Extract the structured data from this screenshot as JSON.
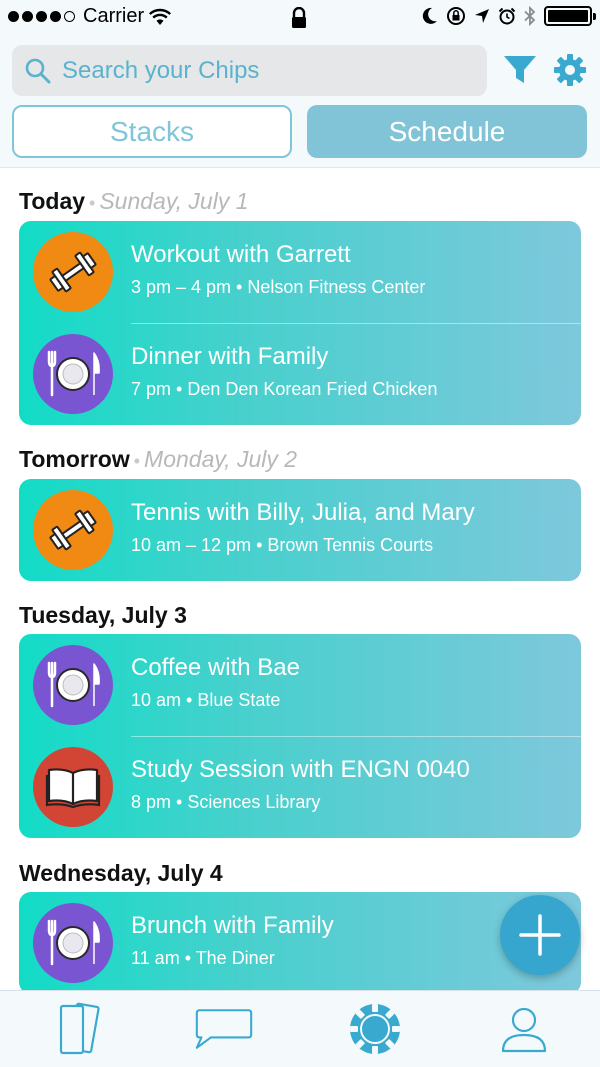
{
  "status_bar": {
    "carrier": "Carrier",
    "signal_dots_filled": 4,
    "signal_dots_total": 5
  },
  "search": {
    "placeholder": "Search your Chips",
    "icon": "search-icon"
  },
  "header": {
    "filter_icon": "filter-icon",
    "settings_icon": "gear-icon",
    "segments": [
      {
        "label": "Stacks",
        "selected": false
      },
      {
        "label": "Schedule",
        "selected": true
      }
    ]
  },
  "days": [
    {
      "label": "Today",
      "date": "Sunday, July 1",
      "events": [
        {
          "title": "Workout with Garrett",
          "subtitle": "3 pm – 4 pm • Nelson Fitness Center",
          "icon": "dumbbell-icon"
        },
        {
          "title": "Dinner with Family",
          "subtitle": "7 pm • Den Den Korean Fried Chicken",
          "icon": "plate-icon"
        }
      ]
    },
    {
      "label": "Tomorrow",
      "date": "Monday, July 2",
      "events": [
        {
          "title": "Tennis with Billy, Julia, and Mary",
          "subtitle": "10 am – 12 pm • Brown Tennis Courts",
          "icon": "dumbbell-icon"
        }
      ]
    },
    {
      "label": "Tuesday, July 3",
      "date": "",
      "events": [
        {
          "title": "Coffee with Bae",
          "subtitle": "10 am • Blue State",
          "icon": "plate-icon"
        },
        {
          "title": "Study Session with ENGN 0040",
          "subtitle": "8 pm • Sciences Library",
          "icon": "book-icon"
        }
      ]
    },
    {
      "label": "Wednesday, July 4",
      "date": "",
      "events": [
        {
          "title": "Brunch with Family",
          "subtitle": "11 am • The Diner",
          "icon": "plate-icon"
        }
      ]
    }
  ],
  "tab_bar": {
    "tabs": [
      "cards-tab-icon",
      "chat-tab-icon",
      "chip-tab-icon",
      "profile-tab-icon"
    ]
  },
  "colors": {
    "accent": "#37a6cf",
    "card_gradient_start": "#12dcc6",
    "card_gradient_end": "#7ec8dc",
    "fitness": "#f08a12",
    "food": "#7a55d2",
    "study": "#d24534"
  }
}
